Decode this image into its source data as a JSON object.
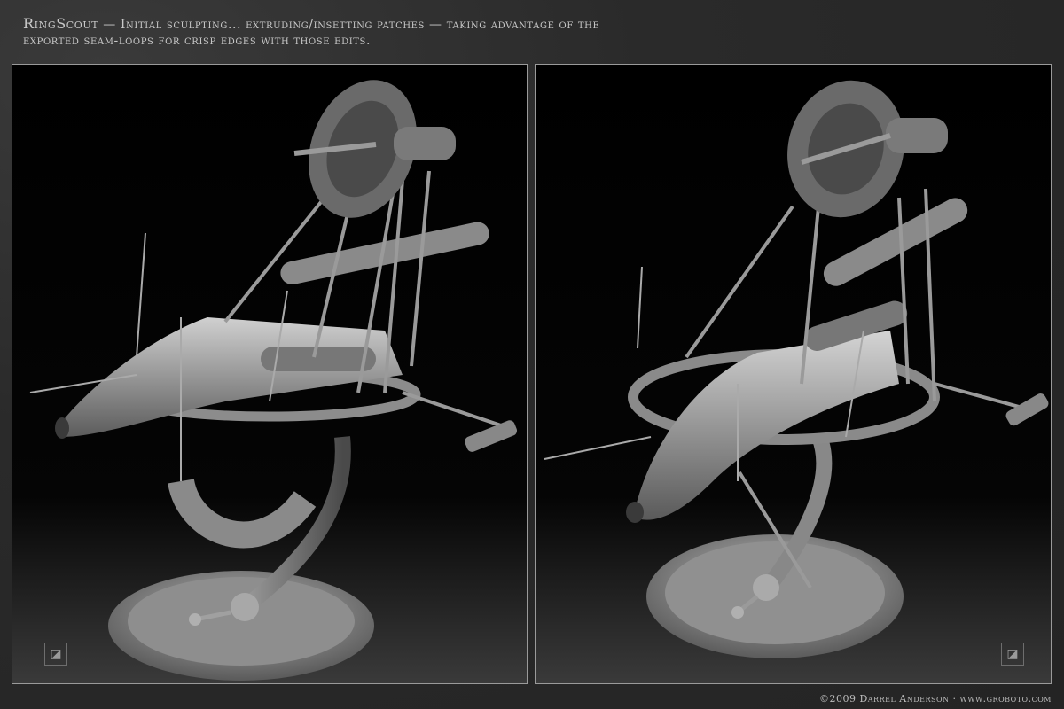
{
  "header": {
    "title": "RingScout",
    "caption_line1": " — Initial sculpting... extruding/insetting patches — taking advantage of the",
    "caption_line2": "exported seam-loops for crisp edges with those edits."
  },
  "panels": {
    "left": {
      "logo_icon": "corner-logo-icon"
    },
    "right": {
      "logo_icon": "corner-logo-icon"
    }
  },
  "footer": {
    "credit": "©2009 Darrel Anderson · www.groboto.com"
  },
  "colors": {
    "background": "#2a2a2a",
    "panel_border": "#9a9a9a",
    "text": "#c8c8c8"
  }
}
